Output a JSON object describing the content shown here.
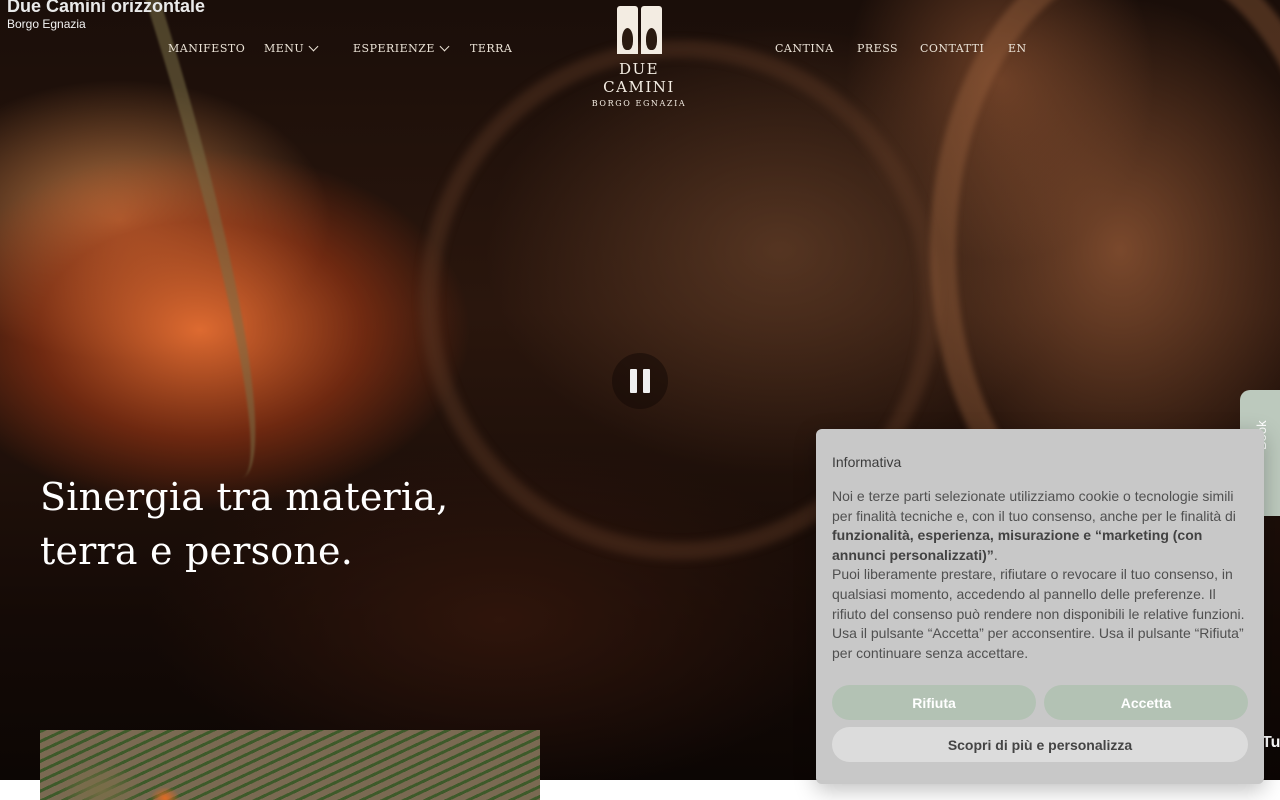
{
  "page": {
    "title": "Due Camini orizzontale",
    "subtitle": "Borgo Egnazia"
  },
  "nav": {
    "left": [
      {
        "label": "MANIFESTO",
        "has_dropdown": false
      },
      {
        "label": "MENU",
        "has_dropdown": true
      },
      {
        "label": "ESPERIENZE",
        "has_dropdown": true
      },
      {
        "label": "TERRA",
        "has_dropdown": false
      }
    ],
    "right": [
      {
        "label": "CANTINA"
      },
      {
        "label": "PRESS"
      },
      {
        "label": "CONTATTI"
      },
      {
        "label": "EN"
      }
    ]
  },
  "logo": {
    "name": "DUE CAMINI",
    "sub": "BORGO EGNAZIA"
  },
  "hero": {
    "line1": "Sinergia tra materia,",
    "line2": "terra e persone.",
    "pause_icon": "pause-icon"
  },
  "book_tab": {
    "label": "Book"
  },
  "right_edge_text": "Tu",
  "cookie": {
    "title": "Informativa",
    "p1_start": "Noi e terze parti selezionate utilizziamo cookie o tecnologie simili per finalità tecniche e, con il tuo consenso, anche per le finalità di ",
    "p1_bold": "funzionalità, esperienza, misurazione e “marketing (con annunci personalizzati)”",
    "p1_end": ".",
    "p2": "Puoi liberamente prestare, rifiutare o revocare il tuo consenso, in qualsiasi momento, accedendo al pannello delle preferenze. Il rifiuto del consenso può rendere non disponibili le relative funzioni.",
    "p3": "Usa il pulsante “Accetta” per acconsentire. Usa il pulsante “Rifiuta” per continuare senza accettare.",
    "reject_label": "Rifiuta",
    "accept_label": "Accetta",
    "more_label": "Scopri di più e personalizza"
  },
  "colors": {
    "cookie_bg": "#c8c8c8",
    "button_green": "#b3c2b4",
    "button_grey": "#dcdcdc",
    "nav_text": "#eae2d6"
  }
}
